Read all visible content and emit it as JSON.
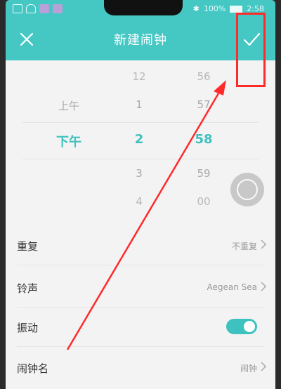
{
  "status_bar": {
    "battery": "100%",
    "time": "2:58"
  },
  "header": {
    "title": "新建闹钟",
    "close_icon": "close-icon",
    "confirm_icon": "check-icon"
  },
  "picker": {
    "period": {
      "above": "上午",
      "selected": "下午"
    },
    "hour": {
      "items": [
        "12",
        "1",
        "2",
        "3",
        "4"
      ],
      "selected": "2"
    },
    "minute": {
      "items": [
        "56",
        "57",
        "58",
        "59",
        "00"
      ],
      "selected": "58"
    }
  },
  "settings": [
    {
      "label": "重复",
      "value": "不重复"
    },
    {
      "label": "铃声",
      "value": "Aegean Sea"
    },
    {
      "label": "振动",
      "toggle_on": true
    },
    {
      "label": "闹钟名",
      "value": "闹钟"
    }
  ],
  "colors": {
    "accent": "#45c7c4",
    "annotation": "#ff2a2a"
  }
}
